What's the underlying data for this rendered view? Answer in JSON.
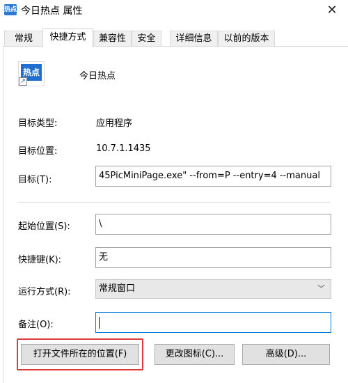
{
  "window": {
    "title": "今日热点 属性",
    "icon_name": "app-shortcut-icon",
    "close_glyph": "✕"
  },
  "tabs": [
    {
      "label": "常规",
      "active": false
    },
    {
      "label": "快捷方式",
      "active": true
    },
    {
      "label": "兼容性",
      "active": false
    },
    {
      "label": "安全",
      "active": false
    },
    {
      "label": "详细信息",
      "active": false
    },
    {
      "label": "以前的版本",
      "active": false
    }
  ],
  "app": {
    "name": "今日热点",
    "icon_text": "热点"
  },
  "fields": {
    "target_type_label": "目标类型:",
    "target_type_value": "应用程序",
    "target_location_label": "目标位置:",
    "target_location_value": "10.7.1.1435",
    "target_label": "目标(T):",
    "target_value": "45PicMiniPage.exe\" --from=P --entry=4 --manual",
    "start_in_label": "起始位置(S):",
    "start_in_value": "\\",
    "shortcut_key_label": "快捷键(K):",
    "shortcut_key_value": "无",
    "run_label": "运行方式(R):",
    "run_value": "常规窗口",
    "comment_label": "备注(O):",
    "comment_value": ""
  },
  "buttons": {
    "open_location": "打开文件所在的位置(F)",
    "change_icon": "更改图标(C)...",
    "advanced": "高级(D)..."
  },
  "colors": {
    "highlight": "#e03a3a",
    "focus": "#0078d7"
  }
}
